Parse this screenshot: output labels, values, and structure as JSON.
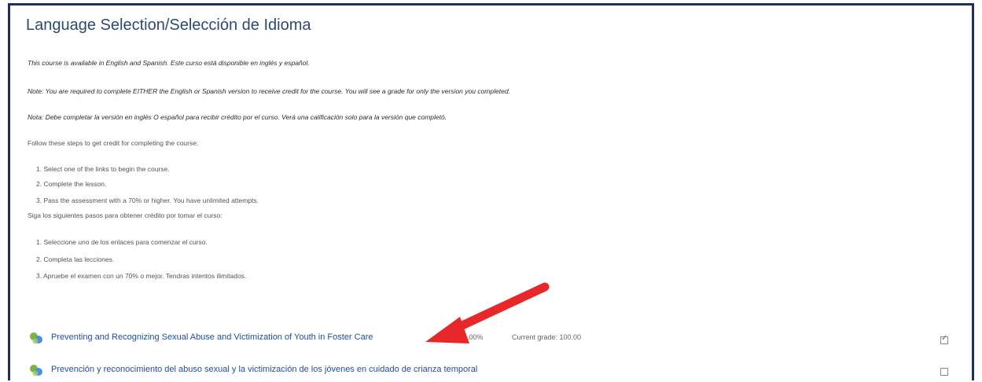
{
  "page": {
    "title": "Language Selection/Selección de Idioma",
    "intro": "This course is available in English and Spanish. Este curso está disponible en inglés y español.",
    "note_en": "Note: You are required to complete EITHER the English or Spanish version to receive credit for the course. You will see a grade for only the version you completed.",
    "note_es": "Nota: Debe completar la versión en inglés O español para recibir crédito por el curso. Verá una calificación solo para la versión que completó.",
    "steps_en_heading": "Follow these steps to get credit for completing the course:",
    "steps_en": [
      "1. Select one of the links to begin the course.",
      "2. Complete the lesson.",
      "3. Pass the assessment with a 70% or higher. You have unlimited attempts."
    ],
    "steps_es_heading": "Siga los siguientes pasos para obtener crédito por tomar el curso:",
    "steps_es": [
      "1. Seleccione uno de los enlaces para comenzar el curso.",
      "2. Completa las lecciones.",
      "3. Apruebe el examen con un 70% o mejor. Tendras intentos ilimitados."
    ]
  },
  "activities": [
    {
      "name": "Preventing and Recognizing Sexual Abuse and Victimization of Youth in Foster Care",
      "progress": "100.00%",
      "grade": "Current grade: 100.00",
      "completed": true
    },
    {
      "name": "Prevención y reconocimiento del abuso sexual y la victimización de los jóvenes en cuidado de crianza temporal",
      "completed": false
    }
  ],
  "colors": {
    "border": "#1f2f5e",
    "title": "#2c4a73",
    "link": "#1f4e9c",
    "arrow": "#e8272a"
  },
  "icons": {
    "activity": "scorm-package-icon",
    "annotation": "red-arrow-annotation"
  }
}
